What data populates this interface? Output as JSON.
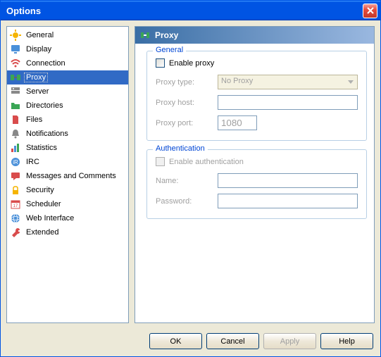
{
  "window": {
    "title": "Options"
  },
  "sidebar": {
    "items": [
      {
        "label": "General",
        "icon": "gear"
      },
      {
        "label": "Display",
        "icon": "monitor"
      },
      {
        "label": "Connection",
        "icon": "wifi"
      },
      {
        "label": "Proxy",
        "icon": "proxy",
        "selected": true
      },
      {
        "label": "Server",
        "icon": "server"
      },
      {
        "label": "Directories",
        "icon": "folder"
      },
      {
        "label": "Files",
        "icon": "file"
      },
      {
        "label": "Notifications",
        "icon": "bell"
      },
      {
        "label": "Statistics",
        "icon": "chart"
      },
      {
        "label": "IRC",
        "icon": "irc"
      },
      {
        "label": "Messages and Comments",
        "icon": "message"
      },
      {
        "label": "Security",
        "icon": "lock"
      },
      {
        "label": "Scheduler",
        "icon": "calendar"
      },
      {
        "label": "Web Interface",
        "icon": "globe"
      },
      {
        "label": "Extended",
        "icon": "wrench"
      }
    ]
  },
  "panel": {
    "title": "Proxy",
    "general": {
      "legend": "General",
      "enable_label": "Enable proxy",
      "type_label": "Proxy type:",
      "type_value": "No Proxy",
      "host_label": "Proxy host:",
      "host_value": "",
      "port_label": "Proxy port:",
      "port_value": "1080"
    },
    "auth": {
      "legend": "Authentication",
      "enable_label": "Enable authentication",
      "name_label": "Name:",
      "name_value": "",
      "password_label": "Password:",
      "password_value": ""
    }
  },
  "footer": {
    "ok": "OK",
    "cancel": "Cancel",
    "apply": "Apply",
    "help": "Help"
  },
  "icon_colors": {
    "gear": "#f5b400",
    "monitor": "#4a90d9",
    "wifi": "#d94c4c",
    "proxy": "#3aa655",
    "server": "#888",
    "folder": "#3aa655",
    "file": "#d94c4c",
    "bell": "#888",
    "chart": "#d94c4c",
    "irc": "#4a90d9",
    "message": "#d94c4c",
    "lock": "#f5b400",
    "calendar": "#d94c4c",
    "globe": "#4a90d9",
    "wrench": "#d94c4c"
  }
}
